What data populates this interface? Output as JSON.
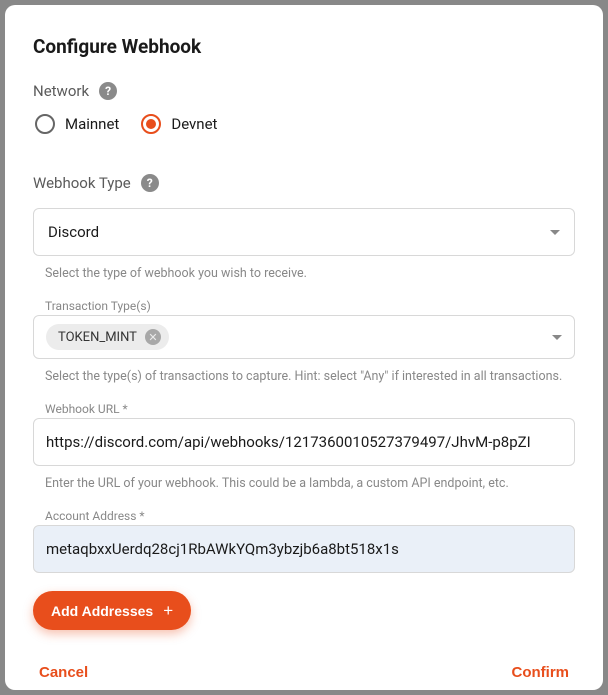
{
  "title": "Configure Webhook",
  "network": {
    "label": "Network",
    "options": {
      "mainnet": "Mainnet",
      "devnet": "Devnet"
    },
    "selected": "devnet"
  },
  "webhookType": {
    "label": "Webhook Type",
    "value": "Discord",
    "helper": "Select the type of webhook you wish to receive."
  },
  "transactionTypes": {
    "label": "Transaction Type(s)",
    "chips": [
      "TOKEN_MINT"
    ],
    "helper": "Select the type(s) of transactions to capture. Hint: select \"Any\" if interested in all transactions."
  },
  "webhookUrl": {
    "label": "Webhook URL *",
    "value": "https://discord.com/api/webhooks/1217360010527379497/JhvM-p8pZI",
    "helper": "Enter the URL of your webhook. This could be a lambda, a custom API endpoint, etc."
  },
  "accountAddress": {
    "label": "Account Address *",
    "value": "metaqbxxUerdq28cj1RbAWkYQm3ybzjb6a8bt518x1s"
  },
  "buttons": {
    "addAddresses": "Add Addresses",
    "cancel": "Cancel",
    "confirm": "Confirm"
  }
}
